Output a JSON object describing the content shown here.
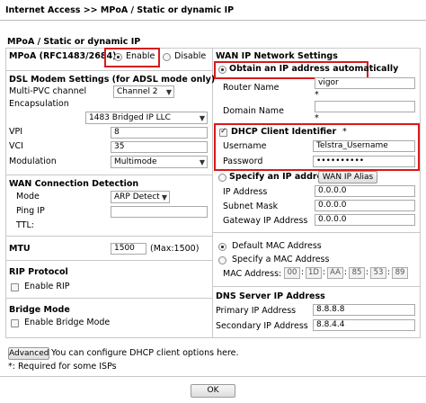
{
  "breadcrumb": "Internet Access >> MPoA / Static or dynamic IP",
  "section_title": "MPoA / Static or dynamic IP",
  "left": {
    "mpoa_label": "MPoA (RFC1483/2684)",
    "enable_label": "Enable",
    "disable_label": "Disable",
    "mpoa_selected": "Enable",
    "dsl_title": "DSL Modem Settings (for ADSL mode only)",
    "multi_pvc_label": "Multi-PVC channel",
    "multi_pvc_value": "Channel 2",
    "encap_label": "Encapsulation",
    "encap_value": "1483 Bridged IP LLC",
    "vpi_label": "VPI",
    "vpi_value": "8",
    "vci_label": "VCI",
    "vci_value": "35",
    "modulation_label": "Modulation",
    "modulation_value": "Multimode",
    "wan_conn_title": "WAN Connection Detection",
    "mode_label": "Mode",
    "mode_value": "ARP Detect",
    "ping_label": "Ping IP",
    "ping_value": "",
    "ttl_label": "TTL:",
    "mtu_label": "MTU",
    "mtu_value": "1500",
    "mtu_hint": "(Max:1500)",
    "rip_title": "RIP Protocol",
    "rip_label": "Enable RIP",
    "bridge_title": "Bridge Mode",
    "bridge_label": "Enable Bridge Mode"
  },
  "right": {
    "wan_ip_title": "WAN IP Network Settings",
    "auto_label": "Obtain an IP address automatically",
    "router_name_label": "Router Name",
    "router_name_value": "vigor",
    "domain_name_label": "Domain Name",
    "domain_name_value": "",
    "asterisk": "*",
    "dhcp_label": "DHCP Client Identifier",
    "dhcp_asterisk": "*",
    "username_label": "Username",
    "username_value": "Telstra_Username",
    "password_label": "Password",
    "password_value": "••••••••••",
    "specify_ip_label": "Specify an IP address",
    "wan_ip_alias_button": "WAN IP Alias",
    "ip_address_label": "IP Address",
    "ip_address_value": "0.0.0.0",
    "subnet_label": "Subnet Mask",
    "subnet_value": "0.0.0.0",
    "gateway_label": "Gateway IP Address",
    "gateway_value": "0.0.0.0",
    "default_mac_label": "Default MAC Address",
    "specify_mac_label": "Specify a MAC Address",
    "mac_label": "MAC Address:",
    "mac_octets": [
      "00",
      "1D",
      "AA",
      "85",
      "53",
      "89"
    ],
    "dns_title": "DNS Server IP Address",
    "primary_dns_label": "Primary IP Address",
    "primary_dns_value": "8.8.8.8",
    "secondary_dns_label": "Secondary IP Address",
    "secondary_dns_value": "8.8.4.4"
  },
  "footer": {
    "advanced_button": "Advanced",
    "advanced_note": "You can configure DHCP client options here.",
    "required_note": "*: Required for some ISPs",
    "ok_button": "OK"
  },
  "colors": {
    "highlight_red": "#d8191e",
    "border_gray": "#c8c8c8"
  }
}
